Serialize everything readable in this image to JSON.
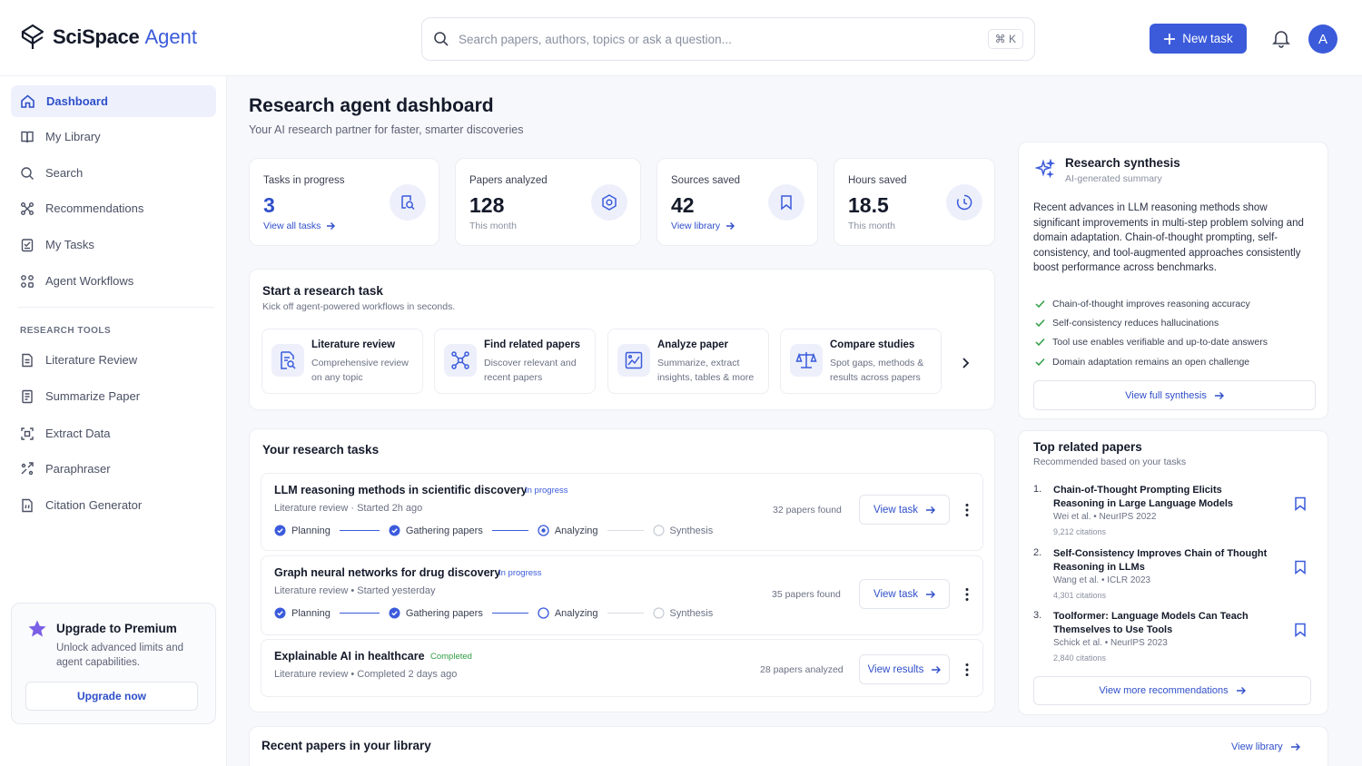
{
  "brand": {
    "name": "SciSpace",
    "product": "Agent"
  },
  "search": {
    "placeholder": "Search papers, authors, topics or ask a question...",
    "shortcut": "⌘ K"
  },
  "header": {
    "new_task_label": "New task",
    "avatar_initial": "A"
  },
  "sidebar": {
    "items": [
      {
        "label": "Dashboard",
        "icon": "home-icon",
        "active": true
      },
      {
        "label": "My Library",
        "icon": "book-icon"
      },
      {
        "label": "Search",
        "icon": "search-icon"
      },
      {
        "label": "Recommendations",
        "icon": "sparkle-nodes-icon"
      },
      {
        "label": "My Tasks",
        "icon": "tasks-icon"
      },
      {
        "label": "Agent Workflows",
        "icon": "grid-icon"
      }
    ],
    "tools_label": "RESEARCH TOOLS",
    "tools": [
      {
        "label": "Literature Review",
        "icon": "document-icon"
      },
      {
        "label": "Summarize Paper",
        "icon": "document-lines-icon"
      },
      {
        "label": "Extract Data",
        "icon": "extract-icon"
      },
      {
        "label": "Paraphraser",
        "icon": "paraphrase-icon"
      },
      {
        "label": "Citation Generator",
        "icon": "citation-icon"
      }
    ],
    "upgrade": {
      "title": "Upgrade to Premium",
      "description": "Unlock advanced limits and agent capabilities.",
      "button": "Upgrade now"
    }
  },
  "main": {
    "title": "Research agent dashboard",
    "subtitle": "Your AI research partner for faster, smarter discoveries",
    "stats": [
      {
        "label": "Tasks in progress",
        "value": "3",
        "foot": "View all tasks",
        "foot_is_link": true,
        "icon": "task-search-icon"
      },
      {
        "label": "Papers analyzed",
        "value": "128",
        "foot": "This month",
        "foot_is_link": false,
        "icon": "hexagon-gear-icon"
      },
      {
        "label": "Sources saved",
        "value": "42",
        "foot": "View library",
        "foot_is_link": true,
        "icon": "bookmark-icon"
      },
      {
        "label": "Hours saved",
        "value": "18.5",
        "foot": "This month",
        "foot_is_link": false,
        "icon": "clock-icon"
      }
    ],
    "start_task": {
      "title": "Start a research task",
      "subtitle": "Kick off agent-powered workflows in seconds.",
      "tools": [
        {
          "title": "Literature review",
          "desc": "Comprehensive review on any topic",
          "icon": "doc-search-icon"
        },
        {
          "title": "Find related papers",
          "desc": "Discover relevant and recent papers",
          "icon": "network-icon"
        },
        {
          "title": "Analyze paper",
          "desc": "Summarize, extract insights, tables & more",
          "icon": "image-chart-icon"
        },
        {
          "title": "Compare studies",
          "desc": "Spot gaps, methods & results across papers",
          "icon": "scale-icon"
        }
      ]
    },
    "tasks": {
      "title": "Your research tasks",
      "items": [
        {
          "title": "LLM reasoning methods in scientific discovery",
          "status": "In progress",
          "meta": "Literature review · Started 2h ago",
          "found": "32 papers found",
          "button": "View task",
          "steps": [
            "Planning",
            "Gathering papers",
            "Analyzing",
            "Synthesis"
          ]
        },
        {
          "title": "Graph neural networks for drug discovery",
          "status": "In progress",
          "meta": "Literature review  •  Started yesterday",
          "found": "35 papers found",
          "button": "View task",
          "steps": [
            "Planning",
            "Gathering papers",
            "Analyzing",
            "Synthesis"
          ]
        },
        {
          "title": "Explainable AI in healthcare",
          "status": "Completed",
          "meta": "Literature review  •  Completed 2 days ago",
          "found": "28 papers analyzed",
          "button": "View results"
        }
      ]
    },
    "recent": {
      "title": "Recent papers in your library",
      "link": "View library"
    }
  },
  "synthesis": {
    "title": "Research synthesis",
    "subtitle": "AI-generated summary",
    "body": "Recent advances in LLM reasoning methods show significant improvements in multi-step problem solving and domain adaptation. Chain-of-thought prompting, self-consistency, and tool-augmented approaches consistently boost performance across benchmarks.",
    "points": [
      "Chain-of-thought improves reasoning accuracy",
      "Self-consistency reduces hallucinations",
      "Tool use enables verifiable and up-to-date answers",
      "Domain adaptation remains an open challenge"
    ],
    "button": "View full synthesis"
  },
  "related": {
    "title": "Top related papers",
    "subtitle": "Recommended based on your tasks",
    "papers": [
      {
        "num": "1.",
        "title": "Chain-of-Thought Prompting Elicits Reasoning in Large Language Models",
        "meta": "Wei et al.  •  NeurIPS 2022",
        "cites": "9,212 citations"
      },
      {
        "num": "2.",
        "title": "Self-Consistency Improves Chain of Thought Reasoning in LLMs",
        "meta": "Wang et al.  •  ICLR 2023",
        "cites": "4,301 citations"
      },
      {
        "num": "3.",
        "title": "Toolformer: Language Models Can Teach Themselves to Use Tools",
        "meta": "Schick et al.  •  NeurIPS 2023",
        "cites": "2,840 citations"
      }
    ],
    "button": "View more recommendations"
  },
  "colors": {
    "accent": "#3b5bdb",
    "success": "#2f9e44",
    "text": "#141a2a",
    "muted": "#6b7184"
  }
}
